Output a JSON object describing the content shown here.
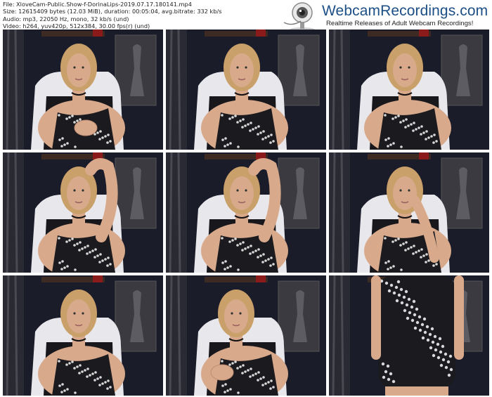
{
  "file_info": {
    "file": "File: XloveCam-Public.Show-f-DorinaLips-2019.07.17.180141.mp4",
    "size": "Size: 12615409 bytes (12.03 MiB), duration: 00:05:04, avg.bitrate: 332 kb/s",
    "audio": "Audio: mp3, 22050 Hz, mono, 32 kb/s (und)",
    "video": "Video: h264, yuv420p, 512x384, 30.00 fps(r) (und)"
  },
  "brand": {
    "title": "WebcamRecordings.com",
    "tagline": "Realtime Releases of Adult Webcam Recordings!",
    "icon": "webcam-icon"
  },
  "thumbnails": [
    {
      "id": 1,
      "pose": "hand-on-chest"
    },
    {
      "id": 2,
      "pose": "arms-down"
    },
    {
      "id": 3,
      "pose": "arms-down"
    },
    {
      "id": 4,
      "pose": "arm-raised"
    },
    {
      "id": 5,
      "pose": "arm-raised"
    },
    {
      "id": 6,
      "pose": "hand-on-face"
    },
    {
      "id": 7,
      "pose": "arms-down"
    },
    {
      "id": 8,
      "pose": "head-tilted"
    },
    {
      "id": 9,
      "pose": "standing-close"
    }
  ],
  "colors": {
    "title": "#1c4f86",
    "background_dark": "#1a1c2a",
    "curtain": "#2a2a34",
    "skin": "#d9a98c",
    "hair": "#c9a06a",
    "dress": "#1b1b1f",
    "chair": "#e8e8ec"
  }
}
